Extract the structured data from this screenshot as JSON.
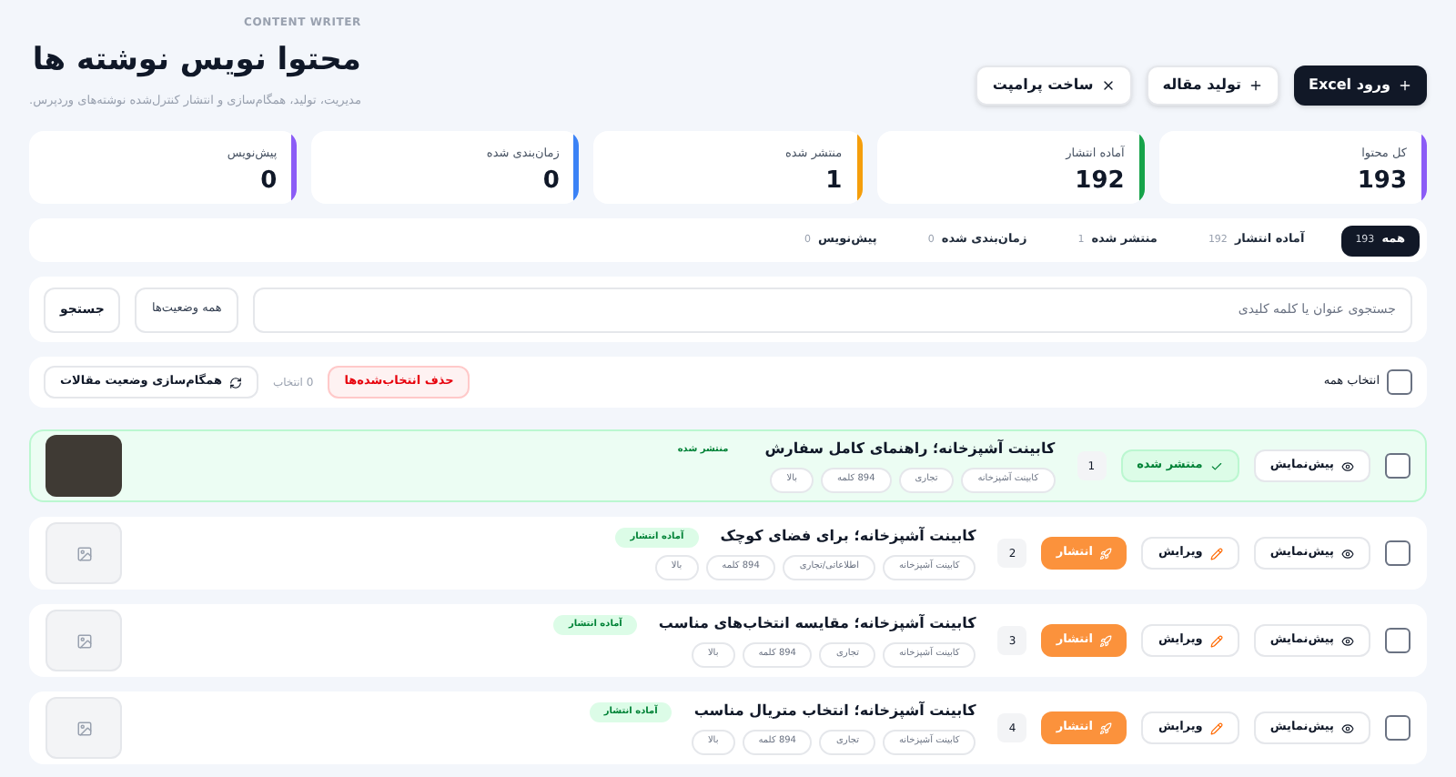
{
  "header": {
    "eyebrow": "CONTENT WRITER",
    "title": "محتوا نویس نوشته ها",
    "subtitle": "مدیریت، تولید، همگام‌سازی و انتشار کنترل‌شده نوشته‌های وردپرس.",
    "buttons": [
      {
        "label": "ورود Excel",
        "kind": "primary"
      },
      {
        "label": "تولید مقاله",
        "kind": "secondary"
      },
      {
        "label": "ساخت پرامپت",
        "kind": "secondary"
      }
    ]
  },
  "stats": [
    {
      "label": "کل محتوا",
      "value": "193",
      "color": "#8b5cf6"
    },
    {
      "label": "آماده انتشار",
      "value": "192",
      "color": "#16a34a"
    },
    {
      "label": "منتشر شده",
      "value": "1",
      "color": "#f59e0b"
    },
    {
      "label": "زمان‌بندی شده",
      "value": "0",
      "color": "#3b82f6"
    },
    {
      "label": "پیش‌نویس",
      "value": "0",
      "color": "#8b5cf6"
    }
  ],
  "tabs": [
    {
      "label": "همه",
      "count": "193",
      "selected": true
    },
    {
      "label": "آماده انتشار",
      "count": "192",
      "selected": false
    },
    {
      "label": "منتشر شده",
      "count": "1",
      "selected": false
    },
    {
      "label": "زمان‌بندی شده",
      "count": "0",
      "selected": false
    },
    {
      "label": "پیش‌نویس",
      "count": "0",
      "selected": false
    }
  ],
  "search": {
    "placeholder": "جستجوی عنوان یا کلمه کلیدی",
    "filter": "همه وضعیت‌ها",
    "button": "جستجو"
  },
  "bulk": {
    "select_all": "انتخاب همه",
    "checked": false,
    "delete": "حذف انتخاب‌شده‌ها",
    "count": "0 انتخاب",
    "sync": "همگام‌سازی وضعیت مقالات"
  },
  "rows": [
    {
      "kind": "published",
      "checked": false,
      "preview": "پیش‌نمایش",
      "action": "منتشر شده",
      "number": "1",
      "title": "کابینت آشپزخانه؛ راهنمای کامل سفارش",
      "status": "منتشر شده",
      "tags": [
        "کابینت آشپزخانه",
        "تجاری",
        "894 کلمه",
        "بالا"
      ],
      "has_photo": true
    },
    {
      "kind": "ready",
      "checked": false,
      "preview": "پیش‌نمایش",
      "edit": "ویرایش",
      "action": "انتشار",
      "number": "2",
      "title": "کابینت آشپزخانه؛ برای فضای کوچک",
      "status": "آماده انتشار",
      "tags": [
        "کابینت آشپزخانه",
        "اطلاعاتی/تجاری",
        "894 کلمه",
        "بالا"
      ],
      "has_photo": false
    },
    {
      "kind": "ready",
      "checked": false,
      "preview": "پیش‌نمایش",
      "edit": "ویرایش",
      "action": "انتشار",
      "number": "3",
      "title": "کابینت آشپزخانه؛ مقایسه انتخاب‌های مناسب",
      "status": "آماده انتشار",
      "tags": [
        "کابینت آشپزخانه",
        "تجاری",
        "894 کلمه",
        "بالا"
      ],
      "has_photo": false
    },
    {
      "kind": "ready",
      "checked": false,
      "preview": "پیش‌نمایش",
      "edit": "ویرایش",
      "action": "انتشار",
      "number": "4",
      "title": "کابینت آشپزخانه؛ انتخاب متریال مناسب",
      "status": "آماده انتشار",
      "tags": [
        "کابینت آشپزخانه",
        "تجاری",
        "894 کلمه",
        "بالا"
      ],
      "has_photo": false
    }
  ]
}
